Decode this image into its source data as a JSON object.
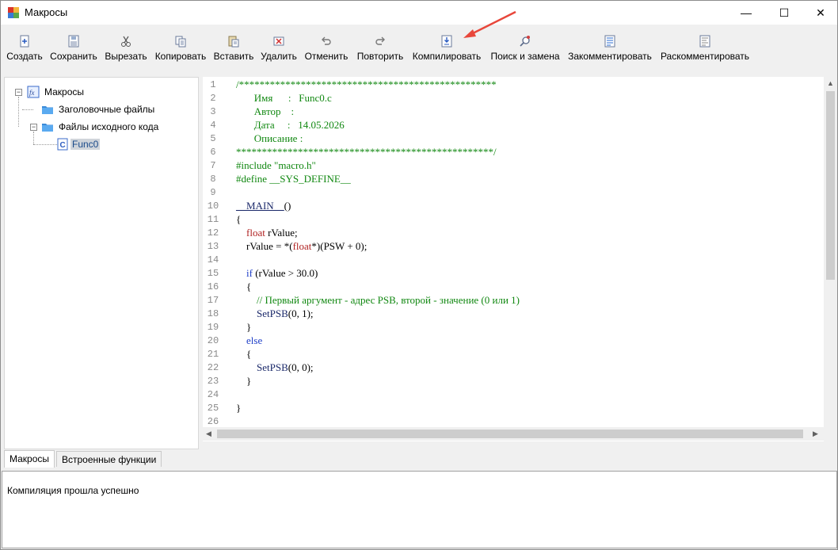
{
  "window": {
    "title": "Макросы",
    "controls": {
      "minimize": "—",
      "maximize": "☐",
      "close": "✕"
    }
  },
  "toolbar": {
    "items": [
      {
        "label": "Создать",
        "icon": "new-file-icon"
      },
      {
        "label": "Сохранить",
        "icon": "save-icon"
      },
      {
        "label": "Вырезать",
        "icon": "scissors-icon"
      },
      {
        "label": "Копировать",
        "icon": "copy-icon"
      },
      {
        "label": "Вставить",
        "icon": "paste-icon"
      },
      {
        "label": "Удалить",
        "icon": "delete-icon"
      },
      {
        "label": "Отменить",
        "icon": "undo-icon"
      },
      {
        "label": "Повторить",
        "icon": "redo-icon"
      },
      {
        "label": "Компилировать",
        "icon": "compile-icon"
      },
      {
        "label": "Поиск и замена",
        "icon": "search-replace-icon"
      },
      {
        "label": "Закомментировать",
        "icon": "comment-icon"
      },
      {
        "label": "Раскомментировать",
        "icon": "uncomment-icon"
      }
    ]
  },
  "tree": {
    "root": "Макросы",
    "headers": "Заголовочные файлы",
    "sources": "Файлы исходного кода",
    "selected_file": "Func0"
  },
  "tabs": {
    "macros": "Макросы",
    "builtin": "Встроенные функции"
  },
  "editor": {
    "line_numbers": [
      "1",
      "2",
      "3",
      "4",
      "5",
      "6",
      "7",
      "8",
      "9",
      "10",
      "11",
      "12",
      "13",
      "14",
      "15",
      "16",
      "17",
      "18",
      "19",
      "20",
      "21",
      "22",
      "23",
      "24",
      "25",
      "26"
    ],
    "header": {
      "stars_open": "/**************************************************",
      "name_label": "Имя",
      "name_value": "Func0.c",
      "author_label": "Автор",
      "date_label": "Дата",
      "date_value": "14.05.2026",
      "desc_label": "Описание",
      "stars_close": "**************************************************/"
    },
    "include": "#include \"macro.h\"",
    "define": "#define __SYS_DEFINE__",
    "main_name": "__MAIN__",
    "main_parens": "()",
    "open_brace": "{",
    "close_brace": "}",
    "float_kw": "float",
    "var_decl": " rValue;",
    "assign_pre": "rValue = *(",
    "assign_post": "*)(PSW + 0);",
    "if_kw": "if",
    "if_cond": " (rValue > 30.0)",
    "comment17": "// Первый аргумент - адрес PSB, второй - значение (0 или 1)",
    "setpsb_name": "SetPSB",
    "setpsb_args1": "(0, 1);",
    "else_kw": "else",
    "setpsb_args0": "(0, 0);"
  },
  "output": {
    "message": "Компиляция прошла успешно"
  },
  "colors": {
    "comment": "#118811",
    "keyword": "#1f3fc8",
    "type": "#b02222",
    "annotation_arrow": "#e8473b"
  }
}
